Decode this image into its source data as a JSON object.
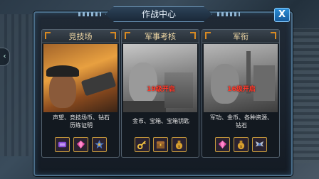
{
  "window": {
    "title": "作战中心",
    "close_label": "X",
    "side_arrow": "‹"
  },
  "cards": [
    {
      "title": "竞技场",
      "locked_text": "",
      "description_lines": [
        "声望、竞技场币、钻石",
        "历练证明"
      ],
      "rewards": [
        "purple-token-icon",
        "pink-diamond-icon",
        "badge-medal-icon"
      ]
    },
    {
      "title": "军事考核",
      "locked_text": "19级开启",
      "description_lines": [
        "金币、宝箱、宝箱钥匙"
      ],
      "rewards": [
        "gold-key-icon",
        "treasure-chest-icon",
        "gold-coin-bag-icon"
      ]
    },
    {
      "title": "军衔",
      "locked_text": "16级开启",
      "description_lines": [
        "军功、金币、各种资源、",
        "钻石"
      ],
      "rewards": [
        "pink-diamond-icon",
        "gold-coin-bag-icon",
        "rank-wings-icon"
      ]
    }
  ],
  "colors": {
    "accent_gold": "#d98a22",
    "locked_red": "#ff3a2a",
    "close_blue": "#2c8fd8"
  }
}
